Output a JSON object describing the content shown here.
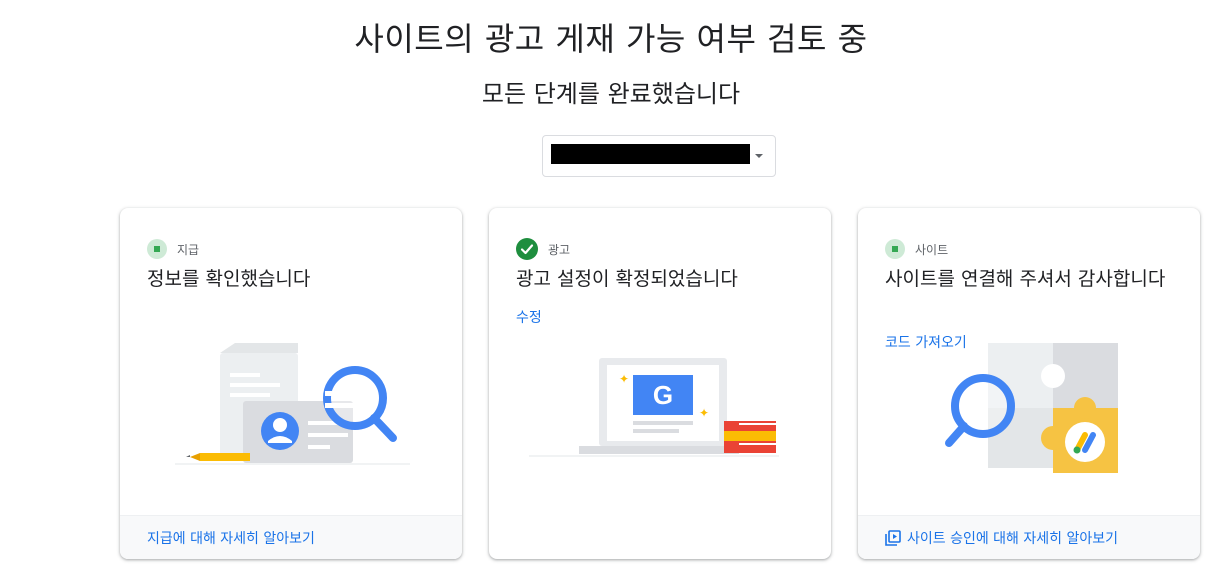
{
  "header": {
    "title": "사이트의 광고 게재 가능 여부 검토 중",
    "subtitle": "모든 단계를 완료했습니다"
  },
  "site_selector": {
    "caret_icon": "chevron-down-icon"
  },
  "cards": [
    {
      "status_icon": "green-square-status-icon",
      "status_label": "지급",
      "headline": "정보를 확인했습니다",
      "footer_link": "지급에 대해 자세히 알아보기"
    },
    {
      "status_icon": "check-circle-icon",
      "status_label": "광고",
      "headline": "광고 설정이 확정되었습니다",
      "action_link": "수정"
    },
    {
      "status_icon": "green-square-status-icon",
      "status_label": "사이트",
      "headline": "사이트를 연결해 주셔서 감사합니다",
      "action_link": "코드 가져오기",
      "footer_icon": "video-library-icon",
      "footer_link": "사이트 승인에 대해 자세히 알아보기"
    }
  ],
  "colors": {
    "accent_blue": "#1a73e8",
    "success_green": "#1e8e3e",
    "status_green_bg": "#ceead6",
    "illustration_blue": "#4285f4",
    "illustration_yellow": "#fbbc04"
  }
}
